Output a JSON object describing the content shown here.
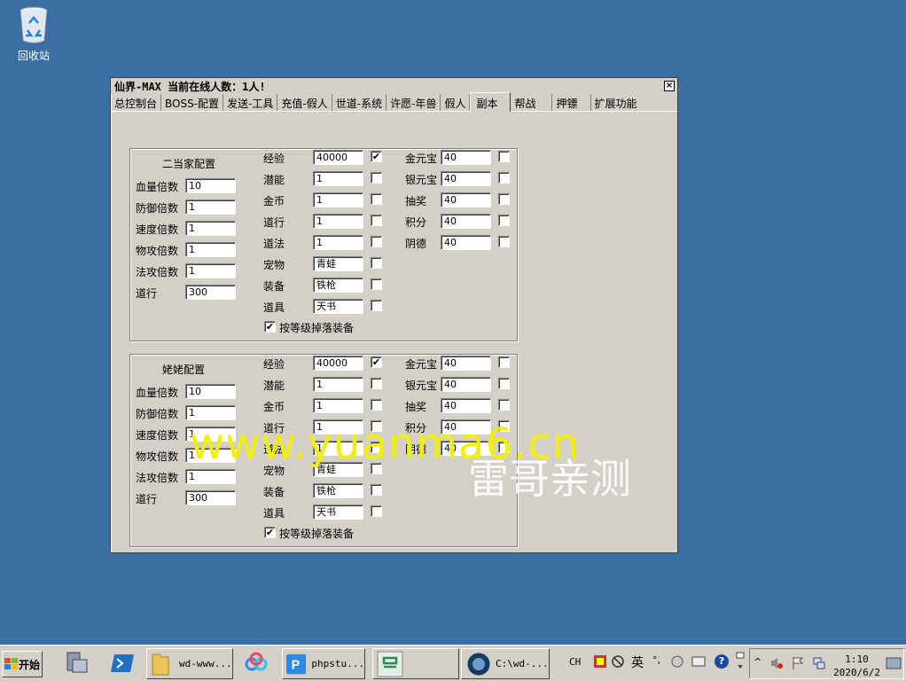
{
  "desktop": {
    "recycle_bin_label": "回收站"
  },
  "window": {
    "title": "仙界-MAX  当前在线人数：1人!",
    "close_label": "×",
    "tabs": [
      {
        "label": "总控制台"
      },
      {
        "label": "BOSS-配置"
      },
      {
        "label": "发送-工具"
      },
      {
        "label": "充值-假人"
      },
      {
        "label": "世道-系统"
      },
      {
        "label": "许愿-年兽"
      },
      {
        "label": "假人"
      },
      {
        "label": "副本",
        "active": true
      },
      {
        "label": "帮战"
      },
      {
        "label": "押镖"
      },
      {
        "label": "扩展功能"
      }
    ]
  },
  "groups": [
    {
      "title": "二当家配置",
      "left_fields": [
        {
          "label": "血量倍数",
          "value": "10"
        },
        {
          "label": "防御倍数",
          "value": "1"
        },
        {
          "label": "速度倍数",
          "value": "1"
        },
        {
          "label": "物攻倍数",
          "value": "1"
        },
        {
          "label": "法攻倍数",
          "value": "1"
        },
        {
          "label": "道行",
          "value": "300"
        }
      ],
      "mid_fields": [
        {
          "label": "经验",
          "value": "40000",
          "checked": true,
          "check": "✔"
        },
        {
          "label": "潜能",
          "value": "1",
          "checked": false,
          "check": ""
        },
        {
          "label": "金币",
          "value": "1",
          "checked": false,
          "check": ""
        },
        {
          "label": "道行",
          "value": "1",
          "checked": false,
          "check": ""
        },
        {
          "label": "道法",
          "value": "1",
          "checked": false,
          "check": ""
        },
        {
          "label": "宠物",
          "value": "青蛙",
          "checked": false,
          "check": ""
        },
        {
          "label": "装备",
          "value": "铁枪",
          "checked": false,
          "check": ""
        },
        {
          "label": "道具",
          "value": "天书",
          "checked": false,
          "check": ""
        }
      ],
      "right_fields": [
        {
          "label": "金元宝",
          "value": "40",
          "checked": false
        },
        {
          "label": "银元宝",
          "value": "40",
          "checked": false
        },
        {
          "label": "抽奖",
          "value": "40",
          "checked": false
        },
        {
          "label": "积分",
          "value": "40",
          "checked": false
        },
        {
          "label": "阴德",
          "value": "40",
          "checked": false
        }
      ],
      "drop_option": {
        "label": "按等级掉落装备",
        "checked": true,
        "check": "✔"
      }
    },
    {
      "title": "姥姥配置",
      "left_fields": [
        {
          "label": "血量倍数",
          "value": "10"
        },
        {
          "label": "防御倍数",
          "value": "1"
        },
        {
          "label": "速度倍数",
          "value": "1"
        },
        {
          "label": "物攻倍数",
          "value": "1"
        },
        {
          "label": "法攻倍数",
          "value": "1"
        },
        {
          "label": "道行",
          "value": "300"
        }
      ],
      "mid_fields": [
        {
          "label": "经验",
          "value": "40000",
          "checked": true,
          "check": "✔"
        },
        {
          "label": "潜能",
          "value": "1",
          "checked": false,
          "check": ""
        },
        {
          "label": "金币",
          "value": "1",
          "checked": false,
          "check": ""
        },
        {
          "label": "道行",
          "value": "1",
          "checked": false,
          "check": ""
        },
        {
          "label": "道法",
          "value": "1",
          "checked": false,
          "check": ""
        },
        {
          "label": "宠物",
          "value": "青蛙",
          "checked": false,
          "check": ""
        },
        {
          "label": "装备",
          "value": "铁枪",
          "checked": false,
          "check": ""
        },
        {
          "label": "道具",
          "value": "天书",
          "checked": false,
          "check": ""
        }
      ],
      "right_fields": [
        {
          "label": "金元宝",
          "value": "40",
          "checked": false
        },
        {
          "label": "银元宝",
          "value": "40",
          "checked": false
        },
        {
          "label": "抽奖",
          "value": "40",
          "checked": false
        },
        {
          "label": "积分",
          "value": "40",
          "checked": false
        },
        {
          "label": "阴德",
          "value": "40",
          "checked": false
        }
      ],
      "drop_option": {
        "label": "按等级掉落装备",
        "checked": true,
        "check": "✔"
      }
    }
  ],
  "watermarks": {
    "site": "www.yuanma6.cn",
    "note": "雷哥亲测"
  },
  "taskbar": {
    "start_label": "开始",
    "buttons": [
      {
        "label": "wd-www..."
      },
      {
        "label": "phpstu..."
      },
      {
        "label": "C:\\wd-..."
      }
    ],
    "tray_lang": "CH",
    "tray_ime": "英",
    "tray_punct": "°,",
    "help_icon": "?",
    "clock_time": "1:10",
    "clock_date": "2020/6/2"
  },
  "colors": {
    "desktop": "#3a6ea5",
    "window": "#d4d0c8",
    "watermark_site": "#f0f000"
  }
}
